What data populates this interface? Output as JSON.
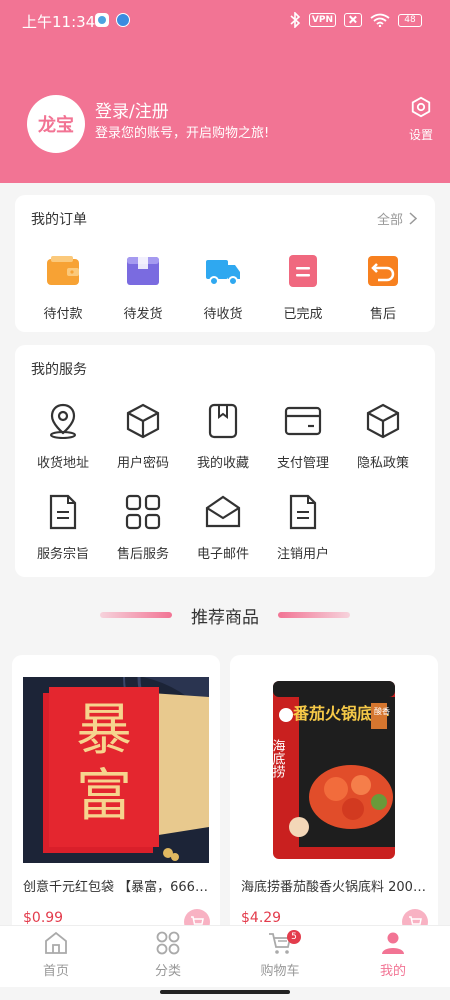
{
  "status_bar": {
    "time": "上午11:34",
    "vpn": "VPN",
    "battery": "48"
  },
  "profile": {
    "avatar_text": "龙宝",
    "title": "登录/注册",
    "subtitle": "登录您的账号，开启购物之旅!",
    "settings_label": "设置"
  },
  "orders": {
    "title": "我的订单",
    "see_all": "全部",
    "items": [
      {
        "label": "待付款",
        "icon": "wallet-icon",
        "color": "#f7a234"
      },
      {
        "label": "待发货",
        "icon": "box-icon",
        "color": "#7a6be0"
      },
      {
        "label": "待收货",
        "icon": "truck-icon",
        "color": "#2fa8f0"
      },
      {
        "label": "已完成",
        "icon": "clipboard-icon",
        "color": "#f0687f"
      },
      {
        "label": "售后",
        "icon": "return-icon",
        "color": "#f7801f"
      }
    ]
  },
  "services": {
    "title": "我的服务",
    "items": [
      {
        "label": "收货地址",
        "icon": "location-pin-icon"
      },
      {
        "label": "用户密码",
        "icon": "cube-icon"
      },
      {
        "label": "我的收藏",
        "icon": "bookmark-icon"
      },
      {
        "label": "支付管理",
        "icon": "card-icon"
      },
      {
        "label": "隐私政策",
        "icon": "cube-icon"
      },
      {
        "label": "服务宗旨",
        "icon": "document-icon"
      },
      {
        "label": "售后服务",
        "icon": "grid-icon"
      },
      {
        "label": "电子邮件",
        "icon": "envelope-icon"
      },
      {
        "label": "注销用户",
        "icon": "document-icon"
      }
    ]
  },
  "recommend": {
    "title": "推荐商品",
    "products": [
      {
        "name": "创意千元红包袋 【暴富，666，...",
        "price": "$0.99",
        "image_text_1": "暴",
        "image_text_2": "富"
      },
      {
        "name": "海底捞番茄酸香火锅底料 200g...",
        "price": "$4.29",
        "brand": "海底捞",
        "product_title": "番茄火锅底料",
        "tag": "酸香"
      }
    ]
  },
  "bottom_nav": {
    "items": [
      {
        "label": "首页",
        "icon": "home-icon"
      },
      {
        "label": "分类",
        "icon": "category-icon"
      },
      {
        "label": "购物车",
        "icon": "cart-icon"
      },
      {
        "label": "我的",
        "icon": "user-icon"
      }
    ],
    "cart_count": "5",
    "active_color": "#f27494"
  },
  "colors": {
    "brand": "#f27494",
    "price": "#e33c4c"
  }
}
